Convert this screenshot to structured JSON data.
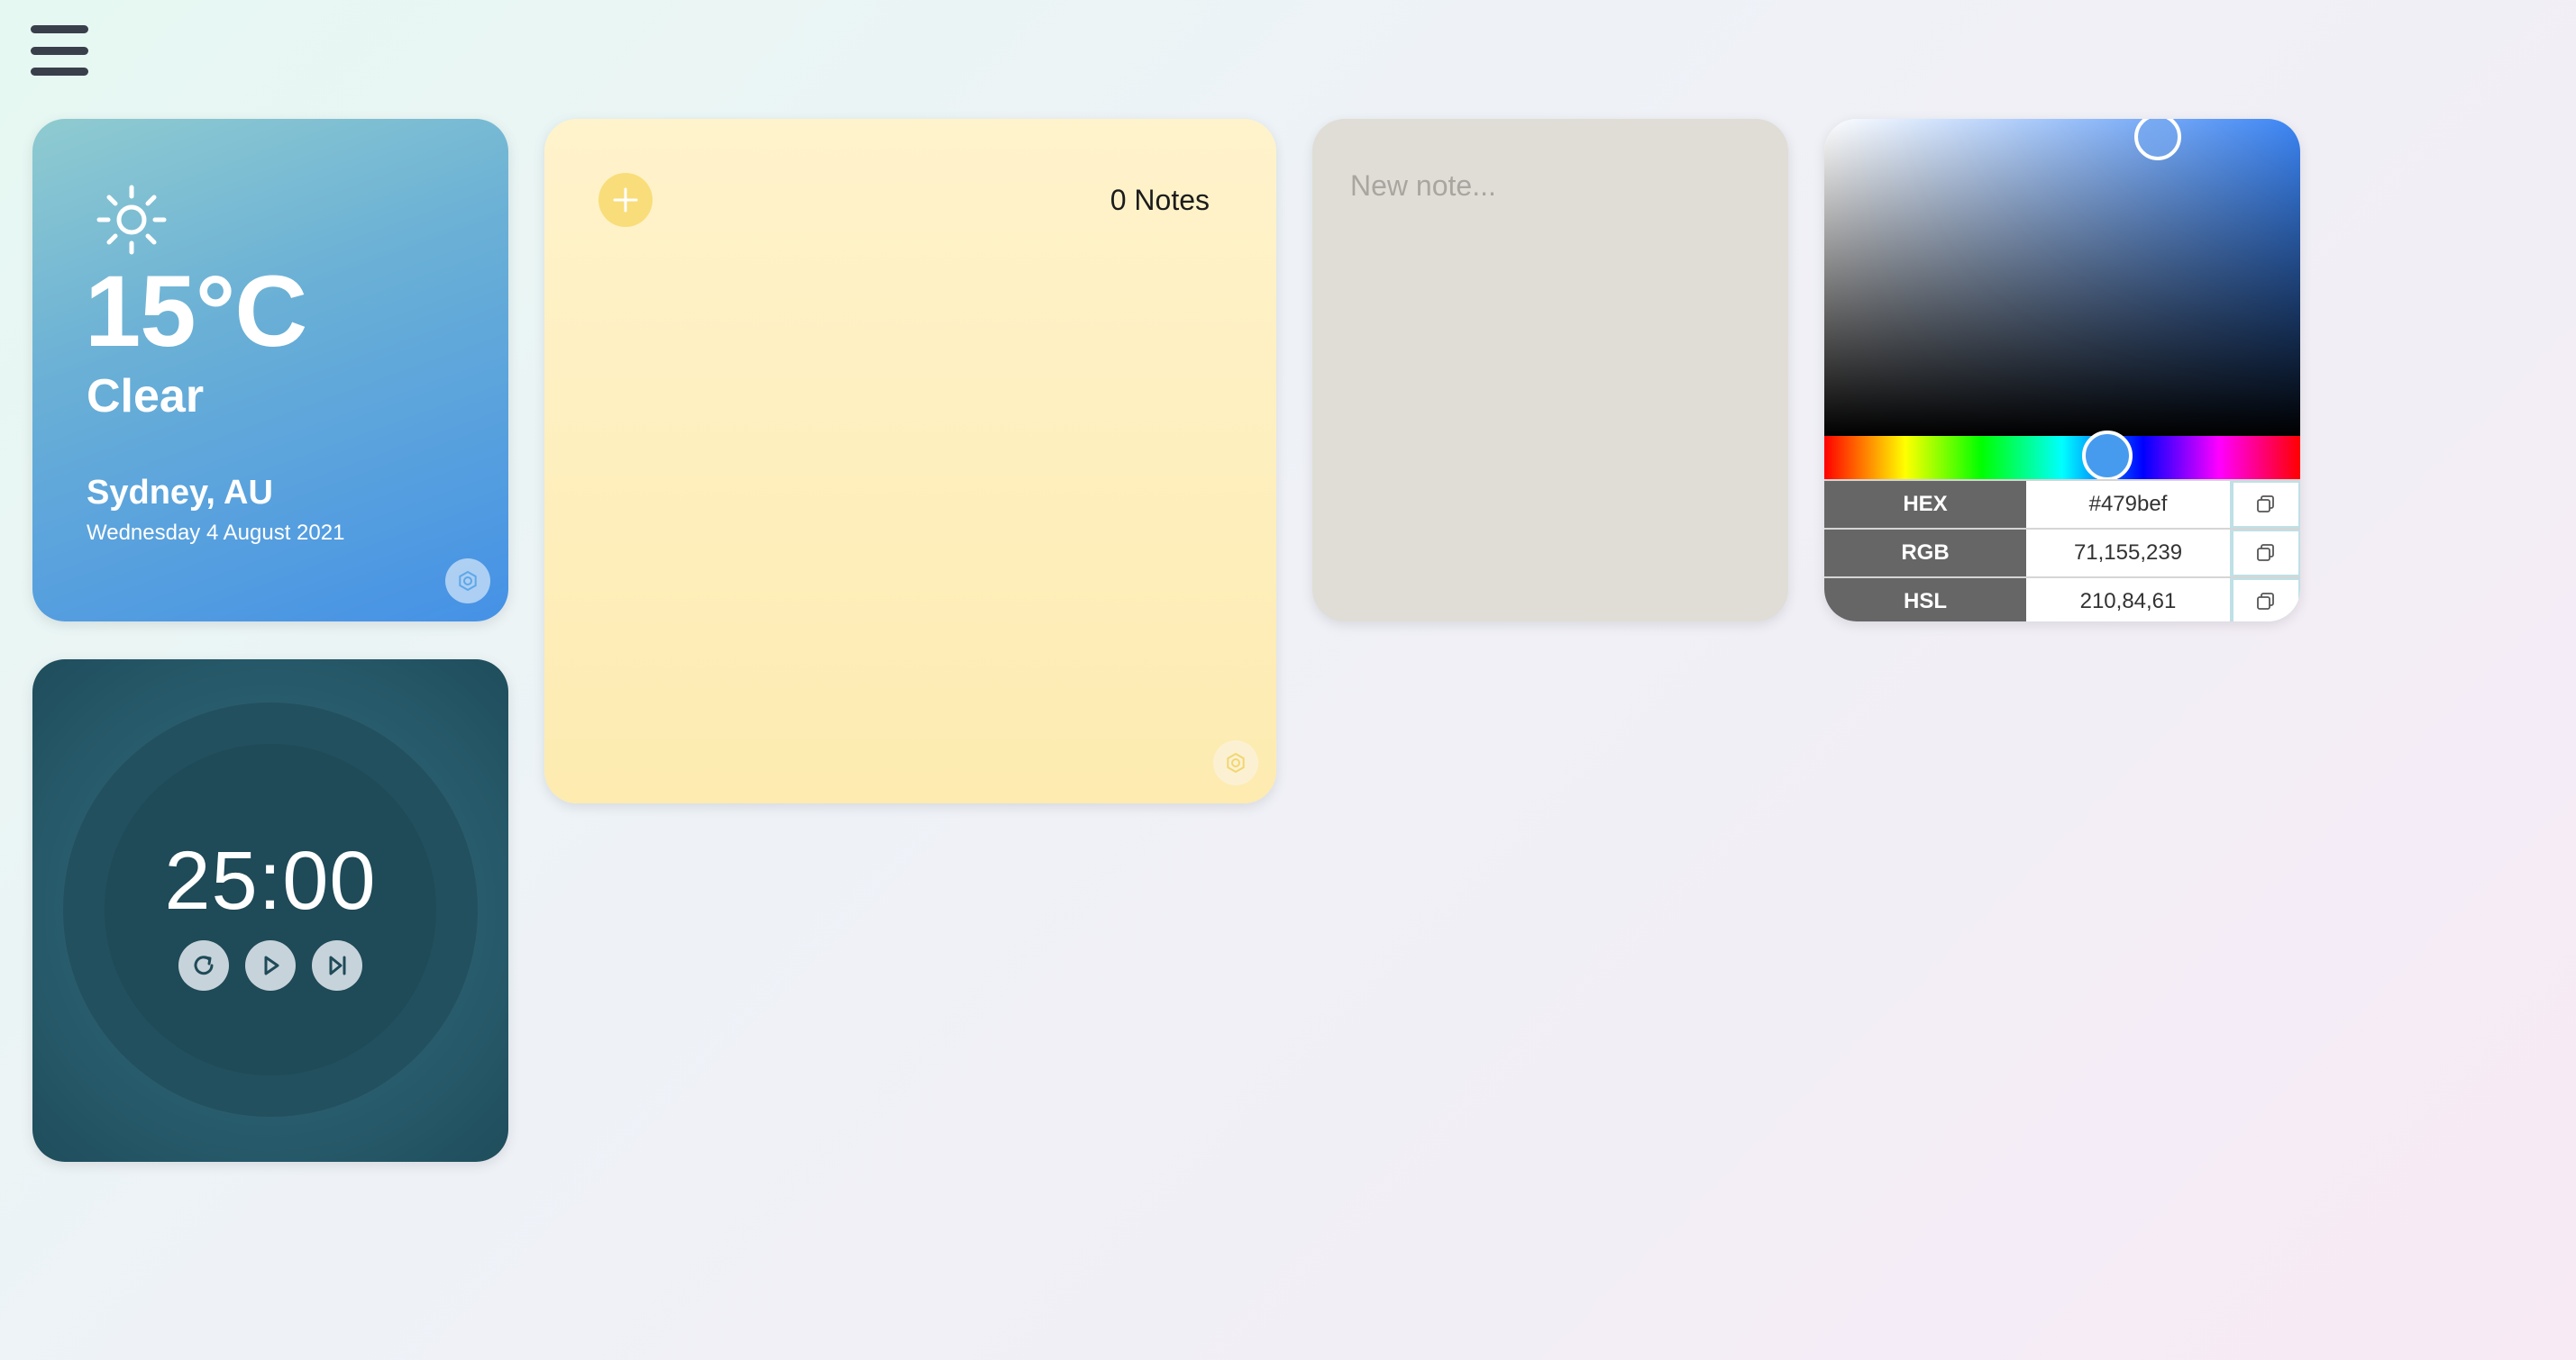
{
  "menu": {
    "icon": "hamburger-menu-icon"
  },
  "weather": {
    "icon": "sun-icon",
    "temperature": "15°C",
    "condition": "Clear",
    "location": "Sydney, AU",
    "date": "Wednesday 4 August 2021",
    "settings_icon": "settings-icon"
  },
  "timer": {
    "time": "25:00",
    "controls": [
      "reset-icon",
      "play-icon",
      "skip-icon"
    ]
  },
  "notes": {
    "count_label": "0 Notes",
    "add_icon": "plus-icon",
    "settings_icon": "settings-icon"
  },
  "new_note": {
    "placeholder": "New note..."
  },
  "color_picker": {
    "hue_color": "#3b85f5",
    "rows": [
      {
        "label": "HEX",
        "value": "#479bef",
        "icon": "copy-icon"
      },
      {
        "label": "RGB",
        "value": "71,155,239",
        "icon": "copy-icon"
      },
      {
        "label": "HSL",
        "value": "210,84,61",
        "icon": "copy-icon"
      }
    ]
  }
}
